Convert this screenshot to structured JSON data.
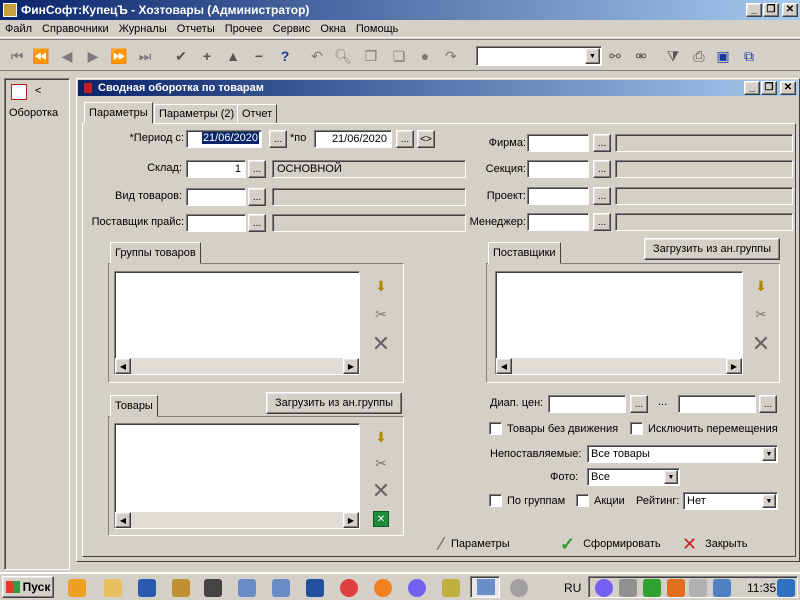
{
  "window": {
    "title": "ФинСофт:КупецЪ - Хозтовары  (Администратор)",
    "min": "_",
    "restore": "❐",
    "close": "✕"
  },
  "menu": [
    "Файл",
    "Справочники",
    "Журналы",
    "Отчеты",
    "Прочее",
    "Сервис",
    "Окна",
    "Помощь"
  ],
  "sidebar": {
    "label": "Оборотка",
    "arrow": "<"
  },
  "subwindow": {
    "title": "Сводная оборотка по товарам",
    "min": "_",
    "restore": "❐",
    "close": "✕"
  },
  "tabs": [
    "Параметры",
    "Параметры (2)",
    "Отчет"
  ],
  "form": {
    "period_label": "*Период с:",
    "period_from": "21/06/2020",
    "period_to_label": "*по",
    "period_to": "21/06/2020",
    "swap": "<>",
    "dots": "...",
    "sklad_label": "Склад:",
    "sklad_code": "1",
    "sklad_name": "ОСНОВНОЙ",
    "vid_label": "Вид товаров:",
    "postavshik_label": "Поставщик прайс:",
    "firma_label": "Фирма:",
    "sekcia_label": "Секция:",
    "proekt_label": "Проект:",
    "manager_label": "Менеджер:"
  },
  "groups": {
    "goods_groups": "Группы товаров",
    "suppliers": "Поставщики",
    "goods": "Товары",
    "load_from_group": "Загрузить из ан.группы"
  },
  "options": {
    "price_range_label": "Диап. цен:",
    "range_dash": "...",
    "no_movement": "Товары без движения",
    "exclude_moves": "Исключить перемещения",
    "unsupplied_label": "Непоставляемые:",
    "unsupplied_value": "Все товары",
    "photo_label": "Фото:",
    "photo_value": "Все",
    "by_groups": "По группам",
    "promo": "Акции",
    "rating_label": "Рейтинг:",
    "rating_value": "Нет"
  },
  "actions": {
    "params": "Параметры",
    "generate": "Сформировать",
    "close": "Закрыть"
  },
  "taskbar": {
    "start": "Пуск",
    "lang": "RU",
    "time": "11:35"
  },
  "colors": {
    "title_from": "#0a246a",
    "title_to": "#a6caf0",
    "face": "#d4d0c8",
    "check_green": "#2e9e2e",
    "close_red": "#c82020"
  }
}
